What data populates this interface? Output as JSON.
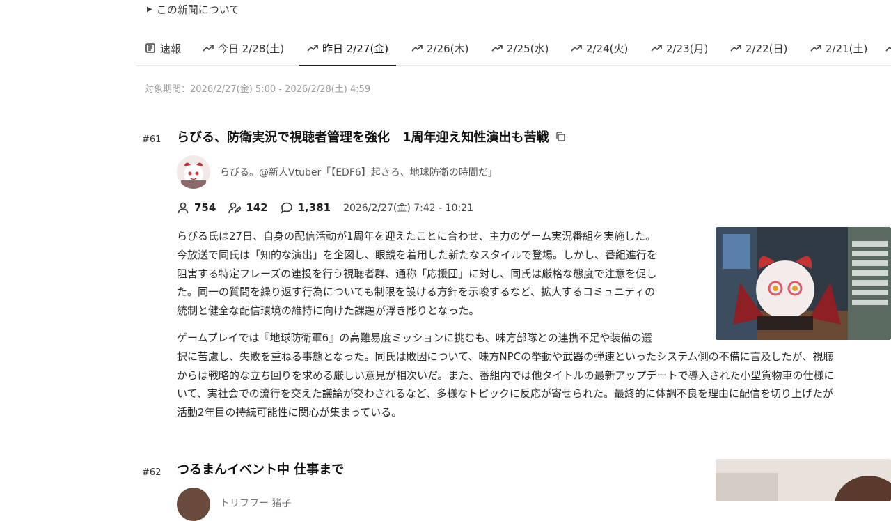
{
  "about": {
    "label": "この新聞について"
  },
  "tabs": [
    {
      "label": "速報",
      "icon": "newspaper-icon"
    },
    {
      "label": "今日 2/28(土)",
      "icon": "trend-icon"
    },
    {
      "label": "昨日 2/27(金)",
      "icon": "trend-icon",
      "active": true
    },
    {
      "label": "2/26(木)",
      "icon": "trend-icon"
    },
    {
      "label": "2/25(水)",
      "icon": "trend-icon"
    },
    {
      "label": "2/24(火)",
      "icon": "trend-icon"
    },
    {
      "label": "2/23(月)",
      "icon": "trend-icon"
    },
    {
      "label": "2/22(日)",
      "icon": "trend-icon"
    },
    {
      "label": "2/21(土)",
      "icon": "trend-icon"
    }
  ],
  "period": "対象期間：2026/2/27(金) 5:00 - 2026/2/28(土) 4:59",
  "articles": [
    {
      "rank": "#61",
      "title": "らびる、防衛実況で視聴者管理を強化　1周年迎え知性演出も苦戦",
      "channel": "らびる。@新人Vtuber「【EDF6】起きろ、地球防衛の時間だ」",
      "viewers": "754",
      "chatters": "142",
      "comments": "1,381",
      "time": "2026/2/27(金) 7:42 - 10:21",
      "body1": [
        "らびる氏は27日、自身の配信活動が1周年を迎えたことに合わせ、主力のゲーム実況番組を実施した。",
        "今放送で同氏は「知的な演出」を企図し、眼鏡を着用した新たなスタイルで登場。しかし、番組進行を",
        "阻害する特定フレーズの連投を行う視聴者群、通称「応援団」に対し、同氏は厳格な態度で注意を促し",
        "た。同一の質問を繰り返す行為についても制限を設ける方針を示唆するなど、拡大するコミュニティの",
        "統制と健全な配信環境の維持に向けた課題が浮き彫りとなった。"
      ],
      "body2": [
        "ゲームプレイでは『地球防衛軍6』の高難易度ミッションに挑むも、味方部隊との連携不足や装備の選",
        "択に苦慮し、失敗を重ねる事態となった。同氏は敗因について、味方NPCの挙動や武器の弾速といったシステム側の不備に言及したが、視聴",
        "からは戦略的な立ち回りを求める厳しい意見が相次いだ。また、番組内では他タイトルの最新アップデートで導入された小型貨物車の仕様に",
        "いて、実社会での流行を交えた議論が交わされるなど、多様なトピックに反応が寄せられた。最終的に体調不良を理由に配信を切り上げたが",
        "活動2年目の持続可能性に関心が集まっている。"
      ]
    },
    {
      "rank": "#62",
      "title": "つるまんイベント中 仕事まで",
      "channel": "トリフフー 猪子"
    }
  ]
}
